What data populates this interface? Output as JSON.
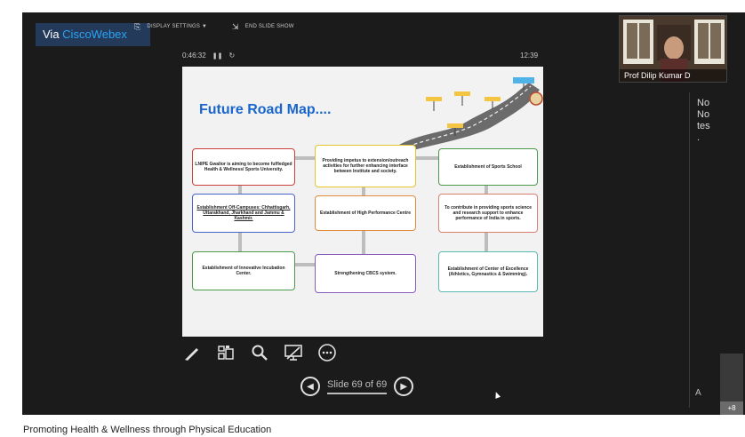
{
  "app": {
    "brand_prefix": "Via ",
    "brand_name": "CiscoWebex"
  },
  "toolbar": {
    "display_settings": "DISPLAY SETTINGS ▼",
    "end_slide_show": "END SLIDE SHOW"
  },
  "playback": {
    "elapsed": "0:46:32",
    "pause_glyph": "❚❚",
    "refresh_glyph": "↻",
    "clock": "12:39"
  },
  "slide": {
    "title": "Future Road Map....",
    "boxes": [
      {
        "text": "LNIPE Gwalior is aiming to become fulfledged Health & Wellness/ Sports University."
      },
      {
        "text": "Providing impetus to extension/outreach activities for further enhancing interface between Institute and society."
      },
      {
        "text": "Establishment of Sports School"
      },
      {
        "text": "Establishment Off-Campuses: Chhattisgarh, Uttarakhand, Jharkhand and Jammu & Kashmir."
      },
      {
        "text": "Establishment of High Performance Centre"
      },
      {
        "text": "To contribute in providing sports science and research support to enhance performance of India in sports."
      },
      {
        "text": "Establishment of Innovative Incubation Center."
      },
      {
        "text": "Strengthening CBCS system."
      },
      {
        "text": "Establishment of Center of Excellence (Athletics, Gymnastics & Swimming)."
      }
    ]
  },
  "tools": [
    "pen-icon",
    "thumbnails-icon",
    "zoom-icon",
    "present-screen-icon",
    "more-icon"
  ],
  "navigation": {
    "label": "Slide 69 of 69",
    "prev_glyph": "◀",
    "next_glyph": "▶"
  },
  "video": {
    "participant_name": "Prof Dilip Kumar D"
  },
  "notes": {
    "text": "No\nNo\ntes\n."
  },
  "sidebar": {
    "font_size_glyph": "A",
    "more_count": "+8"
  },
  "caption": "Promoting Health & Wellness through Physical Education"
}
